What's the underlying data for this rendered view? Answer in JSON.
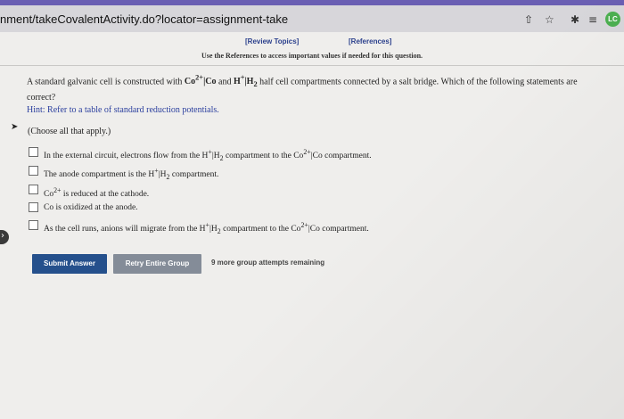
{
  "browser": {
    "url": "nment/takeCovalentActivity.do?locator=assignment-take",
    "profile_initials": "LC"
  },
  "references": {
    "review_topics": "[Review Topics]",
    "references_link": "[References]",
    "note": "Use the References to access important values if needed for this question."
  },
  "question": {
    "prefix": "A standard galvanic cell is constructed with ",
    "middle": " and ",
    "suffix": " half cell compartments connected by a salt bridge. Which of the following statements are correct?"
  },
  "hint": "Hint: Refer to a table of standard reduction potentials.",
  "choose_all": "(Choose all that apply.)",
  "options_text": {
    "o1a": "In the external circuit, electrons flow from the ",
    "o1b": " compartment to the ",
    "o1c": " compartment.",
    "o2a": "The anode compartment is the ",
    "o2b": " compartment.",
    "o3a": " is reduced at the cathode.",
    "o4": "Co is oxidized at the anode.",
    "o5a": "As the cell runs, anions will migrate from the ",
    "o5b": " compartment to the ",
    "o5c": " compartment."
  },
  "buttons": {
    "submit": "Submit Answer",
    "retry": "Retry Entire Group"
  },
  "attempts_text": "9 more group attempts remaining",
  "icons": {
    "share": "share-icon",
    "bookmark": "star-icon",
    "extensions": "puzzle-icon",
    "reading_list": "list-icon"
  }
}
